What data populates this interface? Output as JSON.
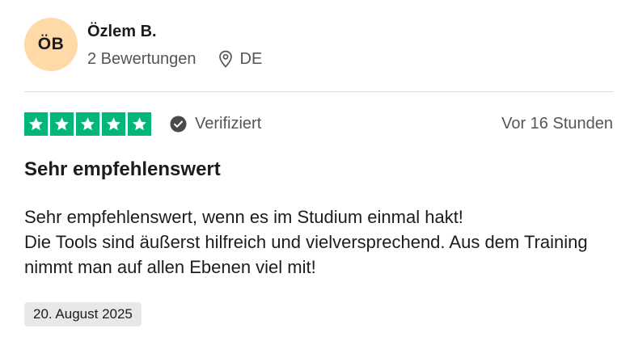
{
  "reviewer": {
    "initials": "ÖB",
    "name": "Özlem B.",
    "review_count": "2 Bewertungen",
    "country": "DE",
    "avatar_color": "#ffd9a8"
  },
  "rating": {
    "stars": 5,
    "max_stars": 5,
    "star_color": "#00b67a",
    "verified_label": "Verifiziert",
    "timestamp": "Vor 16 Stunden"
  },
  "review": {
    "title": "Sehr empfehlenswert",
    "body_lines": [
      "Sehr empfehlenswert, wenn es im Studium einmal hakt!",
      "Die Tools sind äußerst hilfreich und vielversprechend. Aus dem Training nimmt man auf allen Ebenen viel mit!"
    ],
    "experience_date": "20. August 2025"
  },
  "icons": {
    "location": "location-pin-icon",
    "verified": "check-circle-icon",
    "star": "star-icon"
  }
}
